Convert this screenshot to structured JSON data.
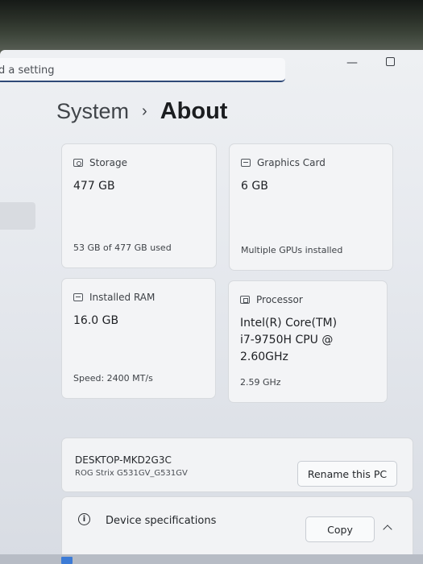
{
  "search": {
    "visible_text": "d a setting"
  },
  "breadcrumb": {
    "parent": "System",
    "separator": "›",
    "current": "About"
  },
  "cards": {
    "storage": {
      "title": "Storage",
      "value": "477 GB",
      "foot": "53 GB of 477 GB used",
      "icon": "storage-icon"
    },
    "gpu": {
      "title": "Graphics Card",
      "value": "6 GB",
      "foot": "Multiple GPUs installed",
      "icon": "graphics-card-icon"
    },
    "ram": {
      "title": "Installed RAM",
      "value": "16.0 GB",
      "foot": "Speed: 2400 MT/s",
      "icon": "ram-icon"
    },
    "cpu": {
      "title": "Processor",
      "value_line1": "Intel(R) Core(TM)",
      "value_line2": "i7-9750H CPU @",
      "value_line3": "2.60GHz",
      "foot": "2.59 GHz",
      "icon": "processor-icon"
    }
  },
  "device": {
    "name": "DESKTOP-MKD2G3C",
    "model": "ROG Strix G531GV_G531GV",
    "rename_label": "Rename this PC"
  },
  "specs": {
    "label": "Device specifications",
    "copy_label": "Copy",
    "icon_glyph": "i"
  },
  "window_controls": {
    "minimize": "—"
  }
}
